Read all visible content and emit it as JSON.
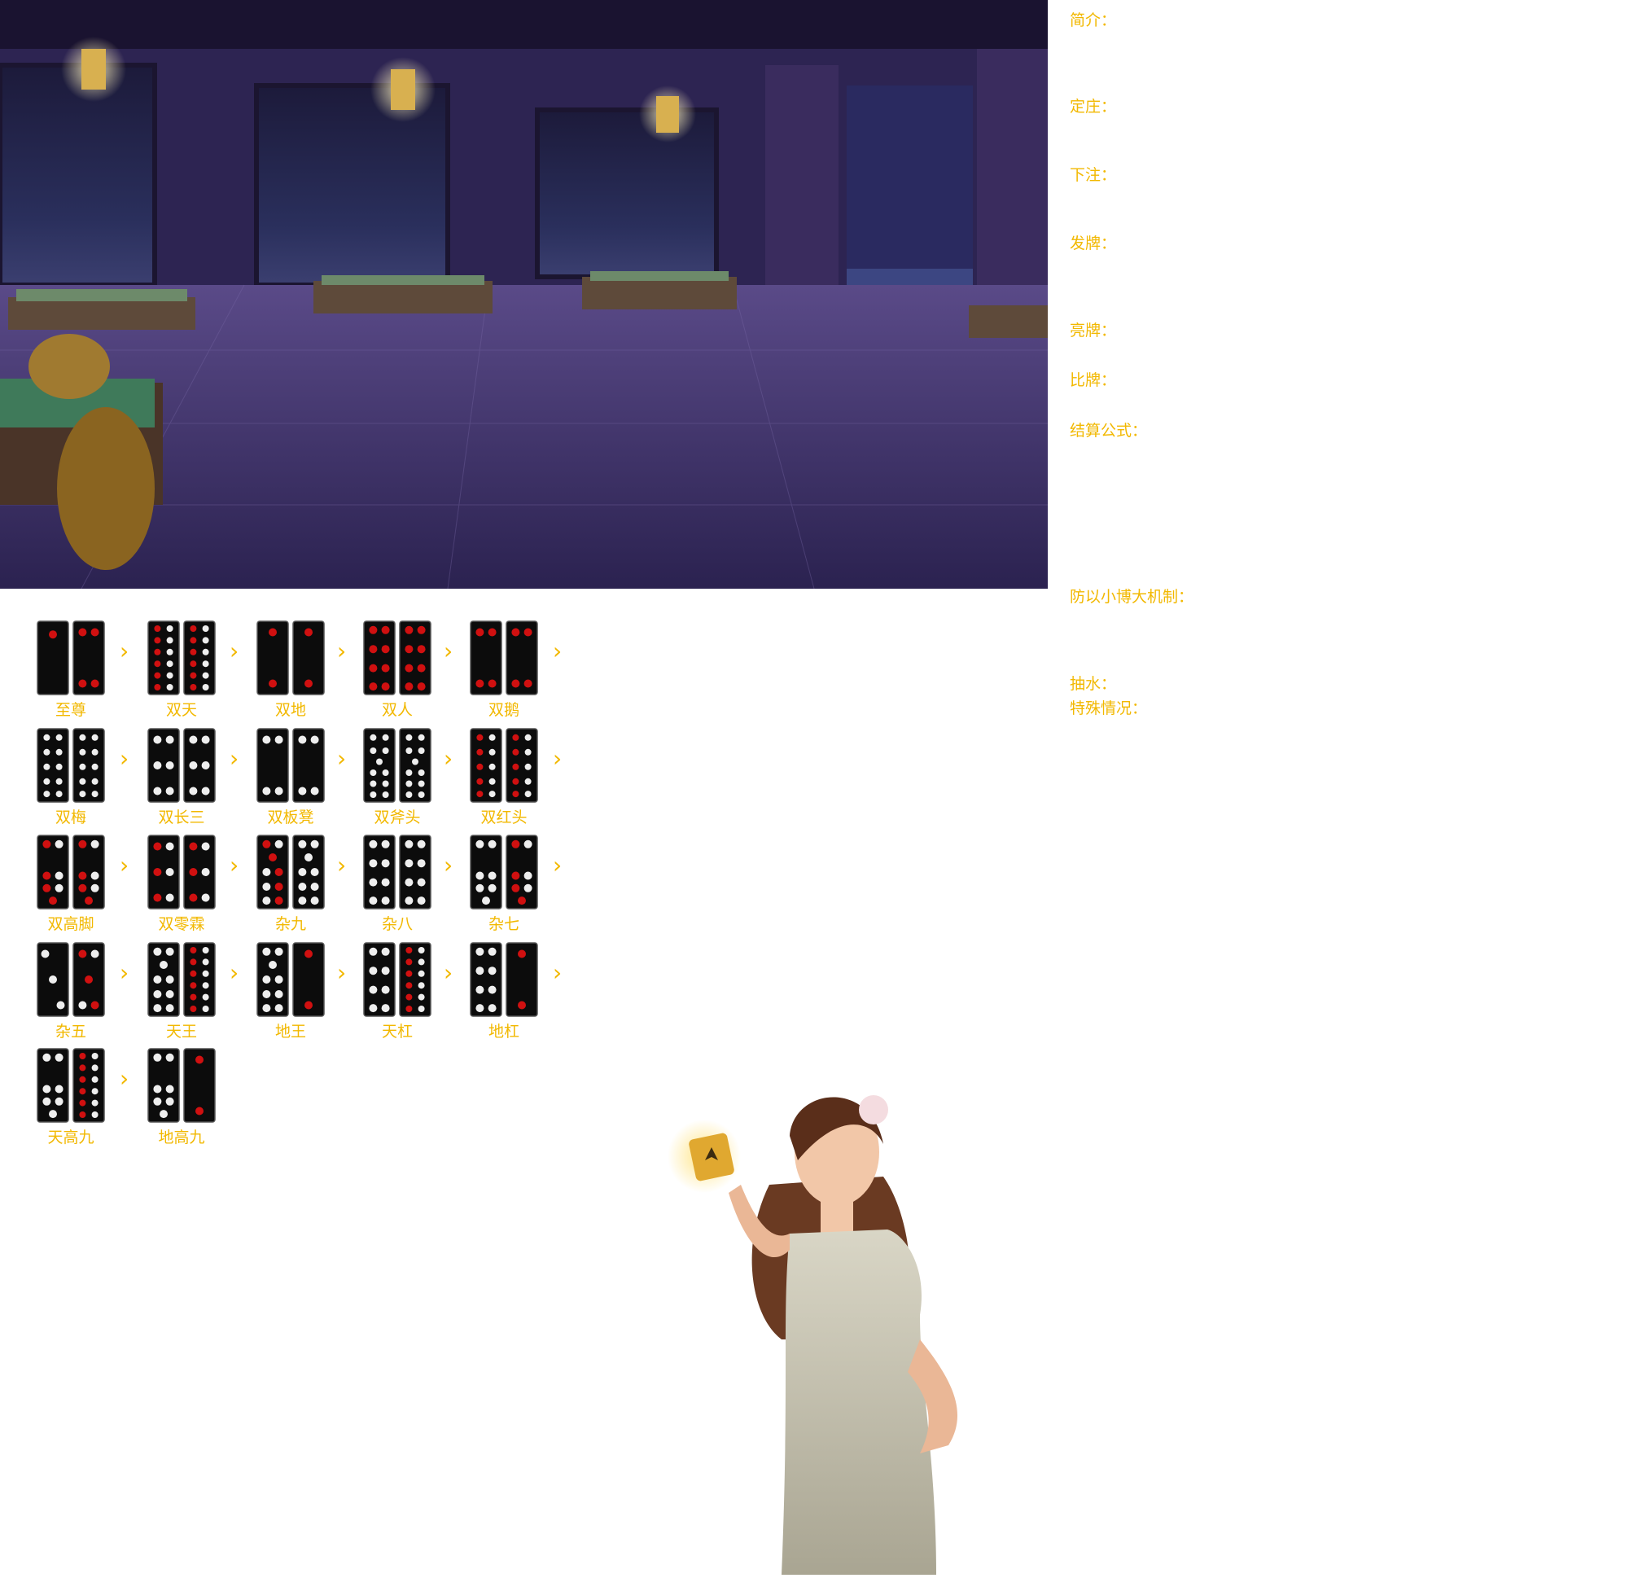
{
  "rules": [
    {
      "label": "简介："
    },
    {
      "label": "定庄："
    },
    {
      "label": "下注："
    },
    {
      "label": "发牌："
    },
    {
      "label": "亮牌："
    },
    {
      "label": "比牌："
    },
    {
      "label": "结算公式："
    },
    {
      "label": "防以小博大机制："
    },
    {
      "label": "抽水："
    },
    {
      "label": "特殊情况："
    }
  ],
  "tiles": [
    {
      "name": "至尊",
      "a": [
        1,
        "r"
      ],
      "b": [
        4,
        "m"
      ]
    },
    {
      "name": "双天",
      "a": [
        12,
        "m"
      ],
      "b": [
        12,
        "m"
      ]
    },
    {
      "name": "双地",
      "a": [
        2,
        "r"
      ],
      "b": [
        2,
        "r"
      ]
    },
    {
      "name": "双人",
      "a": [
        8,
        "r"
      ],
      "b": [
        8,
        "r"
      ]
    },
    {
      "name": "双鹅",
      "a": [
        4,
        "m"
      ],
      "b": [
        4,
        "m"
      ]
    },
    {
      "name": "双梅",
      "a": [
        10,
        "w"
      ],
      "b": [
        10,
        "w"
      ]
    },
    {
      "name": "双长三",
      "a": [
        6,
        "w"
      ],
      "b": [
        6,
        "w"
      ]
    },
    {
      "name": "双板凳",
      "a": [
        4,
        "w"
      ],
      "b": [
        4,
        "w"
      ]
    },
    {
      "name": "双斧头",
      "a": [
        11,
        "w"
      ],
      "b": [
        11,
        "w"
      ]
    },
    {
      "name": "双红头",
      "a": [
        10,
        "m"
      ],
      "b": [
        10,
        "m"
      ]
    },
    {
      "name": "双高脚",
      "a": [
        7,
        "m"
      ],
      "b": [
        7,
        "m"
      ]
    },
    {
      "name": "双零霖",
      "a": [
        6,
        "m"
      ],
      "b": [
        6,
        "m"
      ]
    },
    {
      "name": "杂九",
      "a": [
        9,
        "m"
      ],
      "b": [
        9,
        "w"
      ]
    },
    {
      "name": "杂八",
      "a": [
        8,
        "w"
      ],
      "b": [
        8,
        "w"
      ]
    },
    {
      "name": "杂七",
      "a": [
        7,
        "w"
      ],
      "b": [
        7,
        "m"
      ]
    },
    {
      "name": "杂五",
      "a": [
        3,
        "w"
      ],
      "b": [
        5,
        "m"
      ]
    },
    {
      "name": "天王",
      "a": [
        9,
        "w"
      ],
      "b": [
        12,
        "m"
      ]
    },
    {
      "name": "地王",
      "a": [
        9,
        "w"
      ],
      "b": [
        2,
        "r"
      ]
    },
    {
      "name": "天杠",
      "a": [
        8,
        "w"
      ],
      "b": [
        12,
        "m"
      ]
    },
    {
      "name": "地杠",
      "a": [
        8,
        "w"
      ],
      "b": [
        2,
        "r"
      ]
    },
    {
      "name": "天高九",
      "a": [
        7,
        "w"
      ],
      "b": [
        12,
        "m"
      ]
    },
    {
      "name": "地高九",
      "a": [
        7,
        "w"
      ],
      "b": [
        2,
        "r"
      ]
    }
  ]
}
